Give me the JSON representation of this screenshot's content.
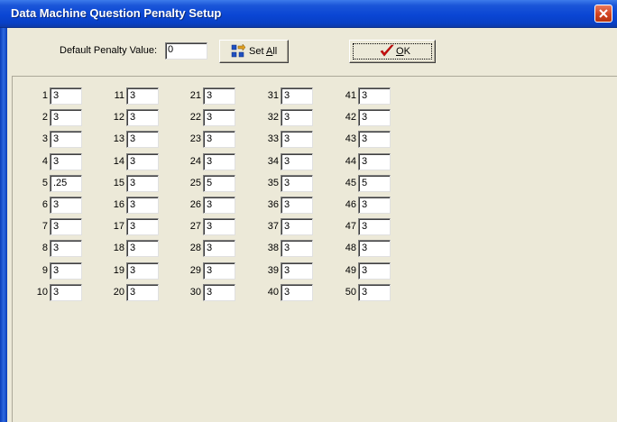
{
  "window": {
    "title": "Data Machine Question Penalty Setup"
  },
  "toolbar": {
    "default_label": "Default Penalty Value:",
    "default_value": "0",
    "set_all_label": "Set All",
    "set_all_mnemonic": "A",
    "ok_label": "OK",
    "ok_mnemonic": "O"
  },
  "questions": [
    {
      "n": "1",
      "v": "3"
    },
    {
      "n": "2",
      "v": "3"
    },
    {
      "n": "3",
      "v": "3"
    },
    {
      "n": "4",
      "v": "3"
    },
    {
      "n": "5",
      "v": ".25"
    },
    {
      "n": "6",
      "v": "3"
    },
    {
      "n": "7",
      "v": "3"
    },
    {
      "n": "8",
      "v": "3"
    },
    {
      "n": "9",
      "v": "3"
    },
    {
      "n": "10",
      "v": "3"
    },
    {
      "n": "11",
      "v": "3"
    },
    {
      "n": "12",
      "v": "3"
    },
    {
      "n": "13",
      "v": "3"
    },
    {
      "n": "14",
      "v": "3"
    },
    {
      "n": "15",
      "v": "3"
    },
    {
      "n": "16",
      "v": "3"
    },
    {
      "n": "17",
      "v": "3"
    },
    {
      "n": "18",
      "v": "3"
    },
    {
      "n": "19",
      "v": "3"
    },
    {
      "n": "20",
      "v": "3"
    },
    {
      "n": "21",
      "v": "3"
    },
    {
      "n": "22",
      "v": "3"
    },
    {
      "n": "23",
      "v": "3"
    },
    {
      "n": "24",
      "v": "3"
    },
    {
      "n": "25",
      "v": "5"
    },
    {
      "n": "26",
      "v": "3"
    },
    {
      "n": "27",
      "v": "3"
    },
    {
      "n": "28",
      "v": "3"
    },
    {
      "n": "29",
      "v": "3"
    },
    {
      "n": "30",
      "v": "3"
    },
    {
      "n": "31",
      "v": "3"
    },
    {
      "n": "32",
      "v": "3"
    },
    {
      "n": "33",
      "v": "3"
    },
    {
      "n": "34",
      "v": "3"
    },
    {
      "n": "35",
      "v": "3"
    },
    {
      "n": "36",
      "v": "3"
    },
    {
      "n": "37",
      "v": "3"
    },
    {
      "n": "38",
      "v": "3"
    },
    {
      "n": "39",
      "v": "3"
    },
    {
      "n": "40",
      "v": "3"
    },
    {
      "n": "41",
      "v": "3"
    },
    {
      "n": "42",
      "v": "3"
    },
    {
      "n": "43",
      "v": "3"
    },
    {
      "n": "44",
      "v": "3"
    },
    {
      "n": "45",
      "v": "5"
    },
    {
      "n": "46",
      "v": "3"
    },
    {
      "n": "47",
      "v": "3"
    },
    {
      "n": "48",
      "v": "3"
    },
    {
      "n": "49",
      "v": "3"
    },
    {
      "n": "50",
      "v": "3"
    }
  ],
  "colors": {
    "titlebar": "#0a46d4",
    "dialog_bg": "#ece9d8",
    "close_button": "#d2431f",
    "ok_check": "#d01010"
  },
  "icons": {
    "close": "close-icon",
    "set_all": "set-all-icon",
    "ok": "checkmark-icon"
  }
}
